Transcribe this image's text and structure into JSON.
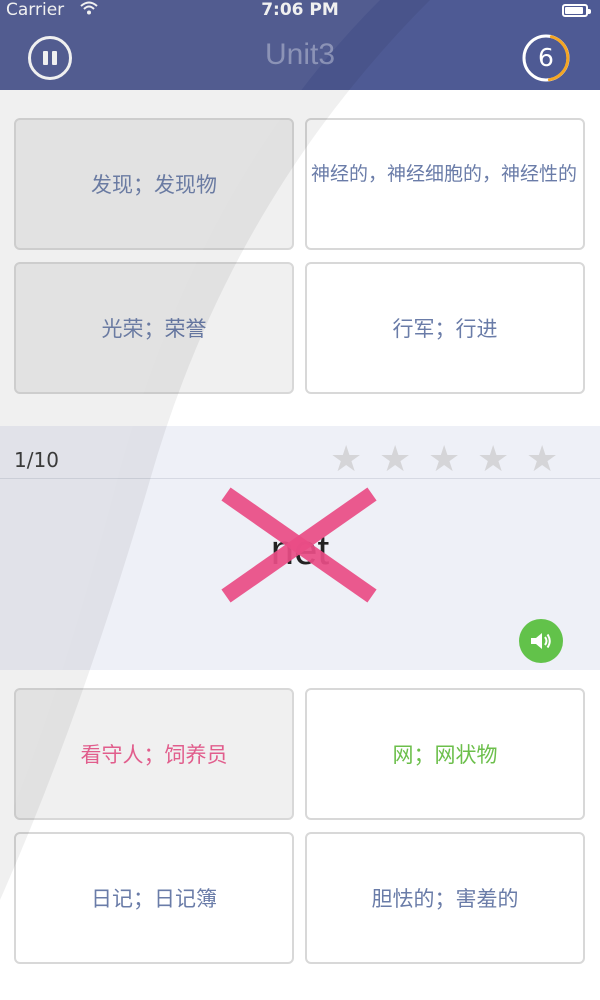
{
  "status_bar": {
    "carrier": "Carrier",
    "time": "7:06 PM",
    "battery_level": 0.9
  },
  "header": {
    "title": "Unit3",
    "timer_value": "6"
  },
  "top_options": [
    {
      "label": "发现；发现物"
    },
    {
      "label": "神经的，神经细胞的，神经性的"
    },
    {
      "label": "光荣；荣誉"
    },
    {
      "label": "行军；行进"
    }
  ],
  "quiz": {
    "progress": "1/10",
    "star_count": 5,
    "word": "net",
    "marked": "wrong"
  },
  "bottom_options": [
    {
      "label": "看守人；饲养员",
      "state": "wrong"
    },
    {
      "label": "网；网状物",
      "state": "correct"
    },
    {
      "label": "日记；日记簿",
      "state": "normal"
    },
    {
      "label": "胆怯的；害羞的",
      "state": "normal"
    }
  ],
  "colors": {
    "header_bg": "#4e5a94",
    "wrong": "#e15d8c",
    "correct": "#6cbf4b",
    "x_mark": "#ea4d86",
    "timer_ring": "#f5a623",
    "speaker": "#62c24a"
  },
  "icons": {
    "pause": "pause-icon",
    "speaker": "speaker-icon",
    "star": "star-icon",
    "wifi": "wifi-icon",
    "battery": "battery-icon"
  }
}
